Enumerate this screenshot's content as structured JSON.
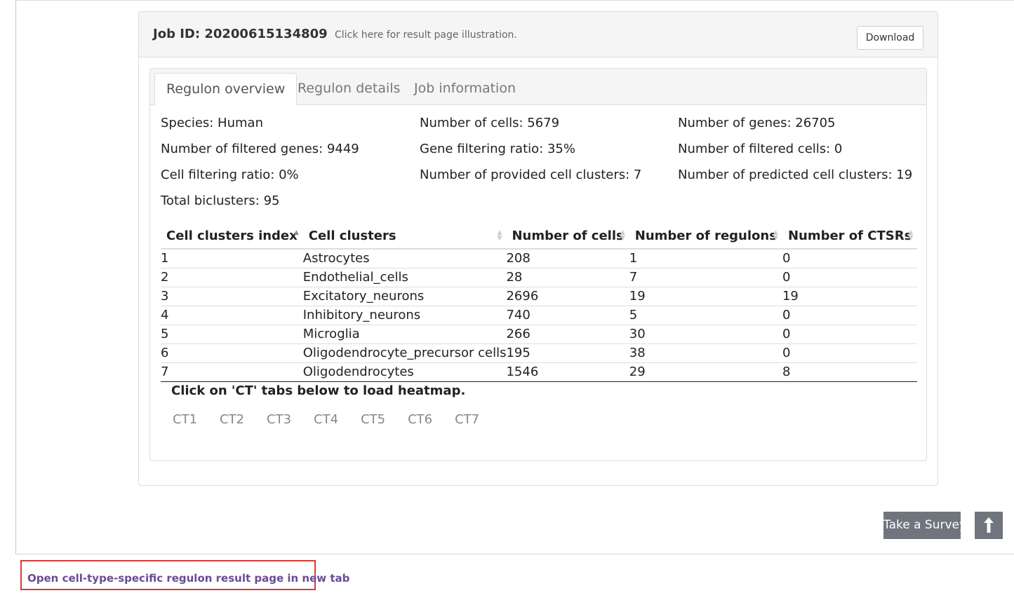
{
  "panel": {
    "job_label": "Job ID: 20200615134809",
    "job_hint": "Click here for result page illustration.",
    "download_label": "Download"
  },
  "tabs": [
    {
      "label": "Regulon overview",
      "active": true
    },
    {
      "label": "Regulon details",
      "active": false
    },
    {
      "label": "Job information",
      "active": false
    }
  ],
  "stats": {
    "species": "Species: Human",
    "cells": "Number of cells: 5679",
    "genes": "Number of genes: 26705",
    "filtered_genes": "Number of filtered genes: 9449",
    "gene_ratio": "Gene filtering ratio: 35%",
    "filtered_cells": "Number of filtered cells: 0",
    "cell_ratio": "Cell filtering ratio: 0%",
    "provided_clusters": "Number of provided cell clusters: 7",
    "predicted_clusters": "Number of predicted cell clusters: 19",
    "biclusters": "Total biclusters: 95"
  },
  "table": {
    "headers": [
      "Cell clusters index",
      "Cell clusters",
      "Number of cells",
      "Number of regulons",
      "Number of CTSRs"
    ],
    "rows": [
      [
        "1",
        "Astrocytes",
        "208",
        "1",
        "0"
      ],
      [
        "2",
        "Endothelial_cells",
        "28",
        "7",
        "0"
      ],
      [
        "3",
        "Excitatory_neurons",
        "2696",
        "19",
        "19"
      ],
      [
        "4",
        "Inhibitory_neurons",
        "740",
        "5",
        "0"
      ],
      [
        "5",
        "Microglia",
        "266",
        "30",
        "0"
      ],
      [
        "6",
        "Oligodendrocyte_precursor cells",
        "195",
        "38",
        "0"
      ],
      [
        "7",
        "Oligodendrocytes",
        "1546",
        "29",
        "8"
      ]
    ]
  },
  "heatmap_note": "Click on 'CT' tabs below to load heatmap.",
  "ct_tabs": [
    "CT1",
    "CT2",
    "CT3",
    "CT4",
    "CT5",
    "CT6",
    "CT7"
  ],
  "survey_label": "Take a Survey",
  "open_link": "Open cell-type-specific regulon result page in new tab",
  "colors": {
    "accent_link": "#6a4c93",
    "highlight_box": "#d93a3a",
    "survey_bg": "#70757d"
  },
  "icons": {
    "back_to_top": "arrow-up-icon"
  }
}
